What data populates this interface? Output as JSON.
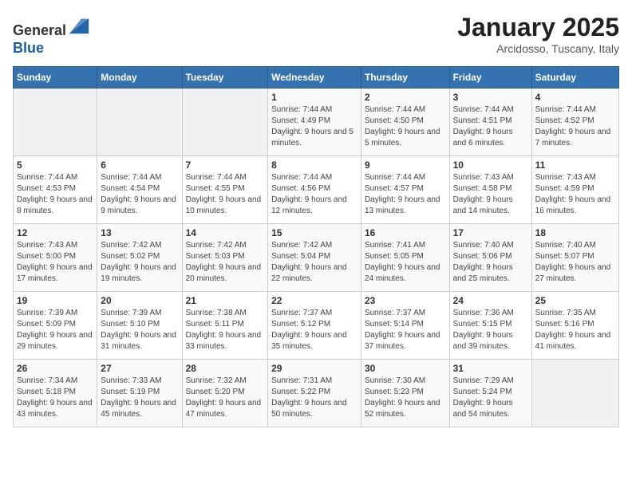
{
  "logo": {
    "general": "General",
    "blue": "Blue"
  },
  "title": "January 2025",
  "location": "Arcidosso, Tuscany, Italy",
  "days_of_week": [
    "Sunday",
    "Monday",
    "Tuesday",
    "Wednesday",
    "Thursday",
    "Friday",
    "Saturday"
  ],
  "weeks": [
    [
      {
        "day": "",
        "info": ""
      },
      {
        "day": "",
        "info": ""
      },
      {
        "day": "",
        "info": ""
      },
      {
        "day": "1",
        "info": "Sunrise: 7:44 AM\nSunset: 4:49 PM\nDaylight: 9 hours and 5 minutes."
      },
      {
        "day": "2",
        "info": "Sunrise: 7:44 AM\nSunset: 4:50 PM\nDaylight: 9 hours and 5 minutes."
      },
      {
        "day": "3",
        "info": "Sunrise: 7:44 AM\nSunset: 4:51 PM\nDaylight: 9 hours and 6 minutes."
      },
      {
        "day": "4",
        "info": "Sunrise: 7:44 AM\nSunset: 4:52 PM\nDaylight: 9 hours and 7 minutes."
      }
    ],
    [
      {
        "day": "5",
        "info": "Sunrise: 7:44 AM\nSunset: 4:53 PM\nDaylight: 9 hours and 8 minutes."
      },
      {
        "day": "6",
        "info": "Sunrise: 7:44 AM\nSunset: 4:54 PM\nDaylight: 9 hours and 9 minutes."
      },
      {
        "day": "7",
        "info": "Sunrise: 7:44 AM\nSunset: 4:55 PM\nDaylight: 9 hours and 10 minutes."
      },
      {
        "day": "8",
        "info": "Sunrise: 7:44 AM\nSunset: 4:56 PM\nDaylight: 9 hours and 12 minutes."
      },
      {
        "day": "9",
        "info": "Sunrise: 7:44 AM\nSunset: 4:57 PM\nDaylight: 9 hours and 13 minutes."
      },
      {
        "day": "10",
        "info": "Sunrise: 7:43 AM\nSunset: 4:58 PM\nDaylight: 9 hours and 14 minutes."
      },
      {
        "day": "11",
        "info": "Sunrise: 7:43 AM\nSunset: 4:59 PM\nDaylight: 9 hours and 16 minutes."
      }
    ],
    [
      {
        "day": "12",
        "info": "Sunrise: 7:43 AM\nSunset: 5:00 PM\nDaylight: 9 hours and 17 minutes."
      },
      {
        "day": "13",
        "info": "Sunrise: 7:42 AM\nSunset: 5:02 PM\nDaylight: 9 hours and 19 minutes."
      },
      {
        "day": "14",
        "info": "Sunrise: 7:42 AM\nSunset: 5:03 PM\nDaylight: 9 hours and 20 minutes."
      },
      {
        "day": "15",
        "info": "Sunrise: 7:42 AM\nSunset: 5:04 PM\nDaylight: 9 hours and 22 minutes."
      },
      {
        "day": "16",
        "info": "Sunrise: 7:41 AM\nSunset: 5:05 PM\nDaylight: 9 hours and 24 minutes."
      },
      {
        "day": "17",
        "info": "Sunrise: 7:40 AM\nSunset: 5:06 PM\nDaylight: 9 hours and 25 minutes."
      },
      {
        "day": "18",
        "info": "Sunrise: 7:40 AM\nSunset: 5:07 PM\nDaylight: 9 hours and 27 minutes."
      }
    ],
    [
      {
        "day": "19",
        "info": "Sunrise: 7:39 AM\nSunset: 5:09 PM\nDaylight: 9 hours and 29 minutes."
      },
      {
        "day": "20",
        "info": "Sunrise: 7:39 AM\nSunset: 5:10 PM\nDaylight: 9 hours and 31 minutes."
      },
      {
        "day": "21",
        "info": "Sunrise: 7:38 AM\nSunset: 5:11 PM\nDaylight: 9 hours and 33 minutes."
      },
      {
        "day": "22",
        "info": "Sunrise: 7:37 AM\nSunset: 5:12 PM\nDaylight: 9 hours and 35 minutes."
      },
      {
        "day": "23",
        "info": "Sunrise: 7:37 AM\nSunset: 5:14 PM\nDaylight: 9 hours and 37 minutes."
      },
      {
        "day": "24",
        "info": "Sunrise: 7:36 AM\nSunset: 5:15 PM\nDaylight: 9 hours and 39 minutes."
      },
      {
        "day": "25",
        "info": "Sunrise: 7:35 AM\nSunset: 5:16 PM\nDaylight: 9 hours and 41 minutes."
      }
    ],
    [
      {
        "day": "26",
        "info": "Sunrise: 7:34 AM\nSunset: 5:18 PM\nDaylight: 9 hours and 43 minutes."
      },
      {
        "day": "27",
        "info": "Sunrise: 7:33 AM\nSunset: 5:19 PM\nDaylight: 9 hours and 45 minutes."
      },
      {
        "day": "28",
        "info": "Sunrise: 7:32 AM\nSunset: 5:20 PM\nDaylight: 9 hours and 47 minutes."
      },
      {
        "day": "29",
        "info": "Sunrise: 7:31 AM\nSunset: 5:22 PM\nDaylight: 9 hours and 50 minutes."
      },
      {
        "day": "30",
        "info": "Sunrise: 7:30 AM\nSunset: 5:23 PM\nDaylight: 9 hours and 52 minutes."
      },
      {
        "day": "31",
        "info": "Sunrise: 7:29 AM\nSunset: 5:24 PM\nDaylight: 9 hours and 54 minutes."
      },
      {
        "day": "",
        "info": ""
      }
    ]
  ]
}
